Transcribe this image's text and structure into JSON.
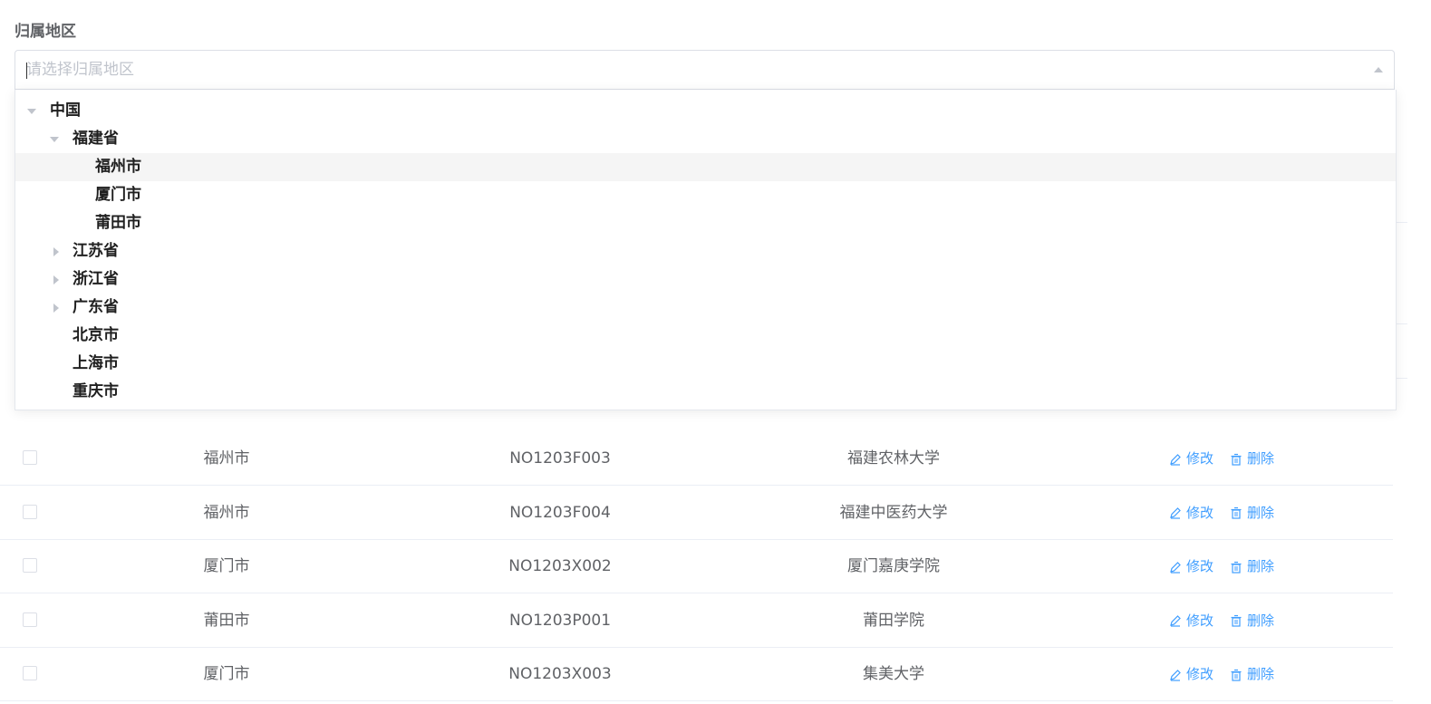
{
  "form": {
    "label": "归属地区",
    "placeholder": "请选择归属地区"
  },
  "tree": [
    {
      "label": "中国",
      "level": 0,
      "toggle": "down"
    },
    {
      "label": "福建省",
      "level": 1,
      "toggle": "down"
    },
    {
      "label": "福州市",
      "level": 2,
      "toggle": "none",
      "hover": true
    },
    {
      "label": "厦门市",
      "level": 2,
      "toggle": "none"
    },
    {
      "label": "莆田市",
      "level": 2,
      "toggle": "none"
    },
    {
      "label": "江苏省",
      "level": 1,
      "toggle": "right"
    },
    {
      "label": "浙江省",
      "level": 1,
      "toggle": "right"
    },
    {
      "label": "广东省",
      "level": 1,
      "toggle": "right"
    },
    {
      "label": "北京市",
      "level": 1,
      "toggle": "none"
    },
    {
      "label": "上海市",
      "level": 1,
      "toggle": "none"
    },
    {
      "label": "重庆市",
      "level": 1,
      "toggle": "none"
    }
  ],
  "table": {
    "rows": [
      {
        "city": "福州市",
        "code": "NO1203F003",
        "name": "福建农林大学"
      },
      {
        "city": "福州市",
        "code": "NO1203F004",
        "name": "福建中医药大学"
      },
      {
        "city": "厦门市",
        "code": "NO1203X002",
        "name": "厦门嘉庚学院"
      },
      {
        "city": "莆田市",
        "code": "NO1203P001",
        "name": "莆田学院"
      },
      {
        "city": "厦门市",
        "code": "NO1203X003",
        "name": "集美大学"
      }
    ],
    "edit_label": "修改",
    "delete_label": "删除"
  },
  "colors": {
    "accent": "#409eff",
    "border": "#ebeef5",
    "text": "#606266",
    "placeholder": "#c0c4cc"
  }
}
